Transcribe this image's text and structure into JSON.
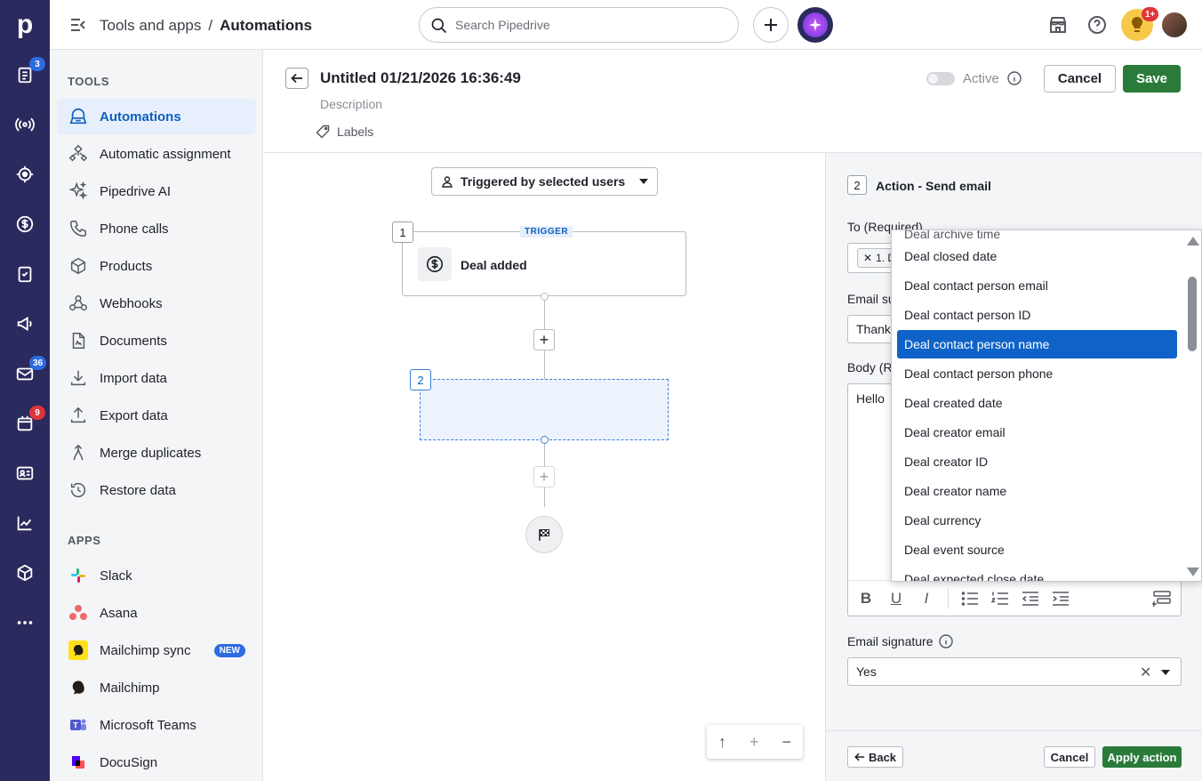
{
  "rail": {
    "logo": "p",
    "badges": {
      "activities": "3",
      "mail": "36",
      "calendar": "9"
    }
  },
  "topbar": {
    "breadcrumb_parent": "Tools and apps",
    "breadcrumb_separator": "/",
    "breadcrumb_current": "Automations",
    "search_placeholder": "Search Pipedrive",
    "notification_badge": "1+"
  },
  "sidepanel": {
    "tools_title": "TOOLS",
    "tools": [
      {
        "label": "Automations",
        "icon": "automation-robot-icon"
      },
      {
        "label": "Automatic assignment",
        "icon": "assignment-icon"
      },
      {
        "label": "Pipedrive AI",
        "icon": "sparkle-icon"
      },
      {
        "label": "Phone calls",
        "icon": "phone-icon"
      },
      {
        "label": "Products",
        "icon": "box-icon"
      },
      {
        "label": "Webhooks",
        "icon": "webhook-icon"
      },
      {
        "label": "Documents",
        "icon": "document-icon"
      },
      {
        "label": "Import data",
        "icon": "download-icon"
      },
      {
        "label": "Export data",
        "icon": "upload-icon"
      },
      {
        "label": "Merge duplicates",
        "icon": "merge-icon"
      },
      {
        "label": "Restore data",
        "icon": "restore-icon"
      }
    ],
    "apps_title": "APPS",
    "apps": [
      {
        "label": "Slack",
        "icon": "slack-icon"
      },
      {
        "label": "Asana",
        "icon": "asana-icon"
      },
      {
        "label": "Mailchimp sync",
        "icon": "mailchimp-icon",
        "badge": "NEW"
      },
      {
        "label": "Mailchimp",
        "icon": "mailchimp-icon"
      },
      {
        "label": "Microsoft Teams",
        "icon": "teams-icon"
      },
      {
        "label": "DocuSign",
        "icon": "docusign-icon"
      }
    ]
  },
  "editor": {
    "title": "Untitled 01/21/2026 16:36:49",
    "description_placeholder": "Description",
    "labels_text": "Labels",
    "active_label": "Active",
    "cancel_label": "Cancel",
    "save_label": "Save"
  },
  "canvas": {
    "trigger_select": "Triggered by selected users",
    "node1_number": "1",
    "node1_tag": "TRIGGER",
    "node1_label": "Deal added",
    "node2_number": "2"
  },
  "action_panel": {
    "step_number": "2",
    "title": "Action - Send email",
    "to_label": "To (Required)",
    "to_chip": "1. D",
    "subject_label": "Email su",
    "subject_value": "Thank",
    "body_label": "Body (R",
    "body_value": "Hello",
    "signature_label": "Email signature",
    "signature_value": "Yes",
    "back_label": "Back",
    "cancel_label": "Cancel",
    "apply_label": "Apply action"
  },
  "dropdown": {
    "partial_top": "Deal archive time",
    "items": [
      "Deal closed date",
      "Deal contact person email",
      "Deal contact person ID",
      "Deal contact person name",
      "Deal contact person phone",
      "Deal created date",
      "Deal creator email",
      "Deal creator ID",
      "Deal creator name",
      "Deal currency",
      "Deal event source",
      "Deal expected close date"
    ],
    "selected": "Deal contact person name"
  },
  "colors": {
    "rail_bg": "#2a2a5e",
    "accent_blue": "#0f63c8",
    "save_green": "#2a7a3a",
    "badge_red": "#e0343a",
    "badge_blue": "#2d6be0"
  }
}
